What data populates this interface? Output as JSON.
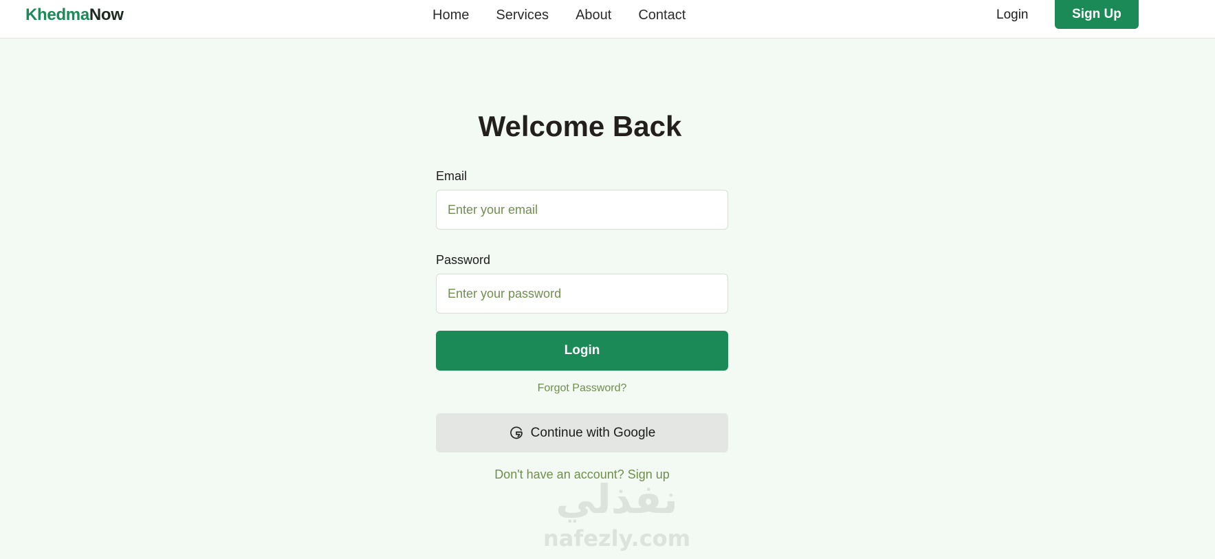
{
  "nav": {
    "logo_part1": "Khedma",
    "logo_part2": "Now",
    "links": [
      "Home",
      "Services",
      "About",
      "Contact"
    ],
    "login_label": "Login",
    "signup_label": "Sign Up"
  },
  "form": {
    "title": "Welcome Back",
    "email_label": "Email",
    "email_placeholder": "Enter your email",
    "password_label": "Password",
    "password_placeholder": "Enter your password",
    "login_button": "Login",
    "forgot_password": "Forgot Password?",
    "google_button": "Continue with Google",
    "signup_prompt": "Don't have an account? Sign up"
  },
  "watermark": {
    "arabic_text": "نفذلي",
    "latin_text": "nafezly.com"
  },
  "colors": {
    "accent": "#1b8a56",
    "background": "#f3f9f3",
    "link": "#6f8f4d",
    "google_button_bg": "#e3e6e2"
  },
  "icons": {
    "google": "google-g-icon"
  }
}
